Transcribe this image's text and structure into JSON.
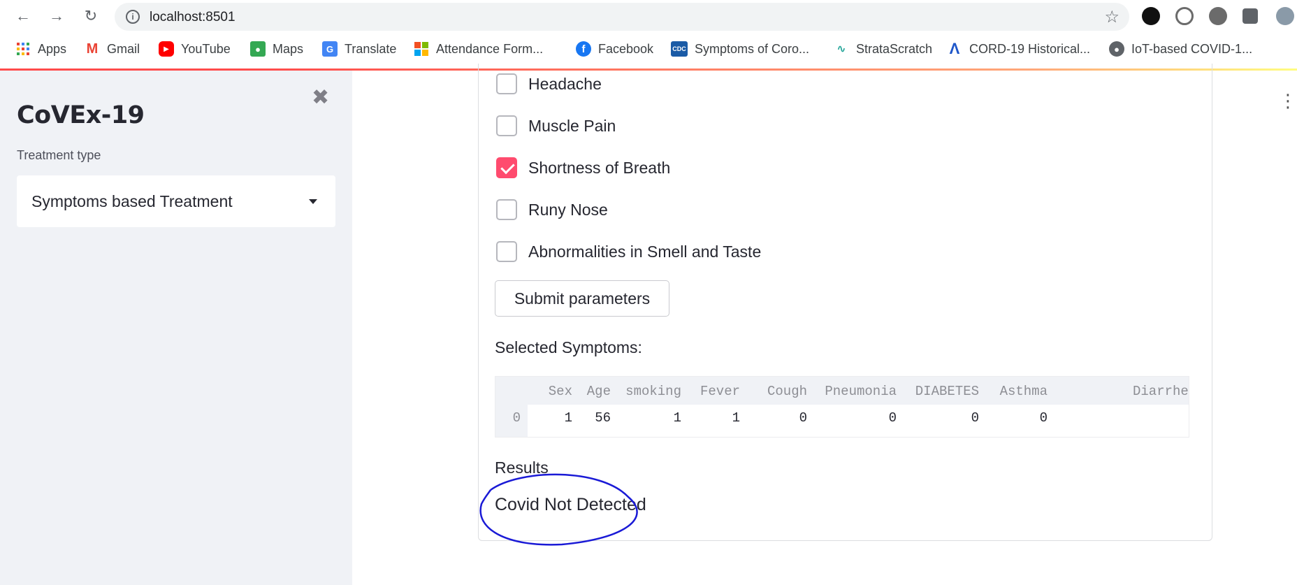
{
  "browser": {
    "url": "localhost:8501",
    "bookmarks": [
      {
        "label": "Apps",
        "icon": "apps-grid-icon",
        "color": "#4285f4"
      },
      {
        "label": "Gmail",
        "icon": "gmail-icon",
        "color": "#ea4335"
      },
      {
        "label": "YouTube",
        "icon": "youtube-icon",
        "color": "#ff0000"
      },
      {
        "label": "Maps",
        "icon": "maps-icon",
        "color": "#34a853"
      },
      {
        "label": "Translate",
        "icon": "translate-icon",
        "color": "#4285f4"
      },
      {
        "label": "Attendance Form...",
        "icon": "microsoft-icon",
        "color": "#f25022"
      },
      {
        "label": "Facebook",
        "icon": "facebook-icon",
        "color": "#1877f2"
      },
      {
        "label": "Symptoms of Coro...",
        "icon": "cdc-icon",
        "color": "#1a5ba6"
      },
      {
        "label": "StrataScratch",
        "icon": "stratascratch-icon",
        "color": "#26a69a"
      },
      {
        "label": "CORD-19 Historical...",
        "icon": "cord19-icon",
        "color": "#1e56c9"
      },
      {
        "label": "IoT-based COVID-1...",
        "icon": "globe-icon",
        "color": "#5f6368"
      }
    ]
  },
  "sidebar": {
    "title": "CoVEx-19",
    "select_label": "Treatment type",
    "select_value": "Symptoms based Treatment"
  },
  "form": {
    "checkboxes": [
      {
        "label": "Headache",
        "checked": false
      },
      {
        "label": "Muscle Pain",
        "checked": false
      },
      {
        "label": "Shortness of Breath",
        "checked": true
      },
      {
        "label": "Runy Nose",
        "checked": false
      },
      {
        "label": "Abnormalities in Smell and Taste",
        "checked": false
      }
    ],
    "submit_label": "Submit parameters",
    "selected_header": "Selected Symptoms:",
    "results_header": "Results",
    "result_text": "Covid Not Detected"
  },
  "dataframe": {
    "columns": [
      "Sex",
      "Age",
      "smoking",
      "Fever",
      "Cough",
      "Pneumonia",
      "DIABETES",
      "Asthma",
      "Diarrhe"
    ],
    "rows": [
      {
        "index": "0",
        "values": [
          "1",
          "56",
          "1",
          "1",
          "0",
          "0",
          "0",
          "0",
          ""
        ]
      }
    ]
  },
  "colors": {
    "accent": "#ff4b6e",
    "sidebar_bg": "#f0f2f6",
    "annotation": "#1a1ad6"
  }
}
